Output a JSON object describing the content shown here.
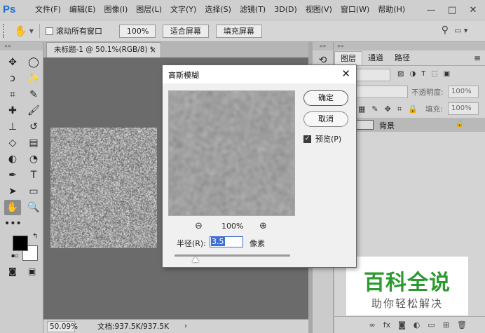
{
  "app": {
    "logo": "Ps",
    "menu": [
      "文件(F)",
      "编辑(E)",
      "图像(I)",
      "图层(L)",
      "文字(Y)",
      "选择(S)",
      "滤镜(T)",
      "3D(D)",
      "视图(V)",
      "窗口(W)",
      "帮助(H)"
    ],
    "window_controls": {
      "minimize": "—",
      "maximize": "□",
      "close": "✕"
    }
  },
  "options_bar": {
    "scroll_all_label": "滚动所有窗口",
    "zoom_value": "100%",
    "fit_screen_label": "适合屏幕",
    "fill_screen_label": "填充屏幕"
  },
  "toolbar": {
    "header": "««",
    "tools": [
      {
        "name": "move-tool",
        "glyph": "✥"
      },
      {
        "name": "ellipse-marquee-tool",
        "glyph": "◯"
      },
      {
        "name": "lasso-tool",
        "glyph": "ↄ"
      },
      {
        "name": "magic-wand-tool",
        "glyph": "✨"
      },
      {
        "name": "crop-tool",
        "glyph": "⌗"
      },
      {
        "name": "eyedropper-tool",
        "glyph": "✎"
      },
      {
        "name": "healing-brush-tool",
        "glyph": "✚"
      },
      {
        "name": "brush-tool",
        "glyph": "🖌"
      },
      {
        "name": "clone-stamp-tool",
        "glyph": "⊥"
      },
      {
        "name": "history-brush-tool",
        "glyph": "↺"
      },
      {
        "name": "eraser-tool",
        "glyph": "◇"
      },
      {
        "name": "gradient-tool",
        "glyph": "▤"
      },
      {
        "name": "blur-tool",
        "glyph": "◐"
      },
      {
        "name": "dodge-tool",
        "glyph": "◔"
      },
      {
        "name": "pen-tool",
        "glyph": "✒"
      },
      {
        "name": "type-tool",
        "glyph": "T"
      },
      {
        "name": "path-selection-tool",
        "glyph": "➤"
      },
      {
        "name": "rectangle-tool",
        "glyph": "▭"
      },
      {
        "name": "hand-tool",
        "glyph": "✋"
      },
      {
        "name": "zoom-tool",
        "glyph": "🔍"
      },
      {
        "name": "more-tools",
        "glyph": "•••"
      }
    ],
    "active_tool": "hand-tool",
    "foreground_color": "#000000",
    "background_color": "#ffffff"
  },
  "document": {
    "tab_title": "未标题-1 @ 50.1%(RGB/8) *",
    "tab_close": "×",
    "zoom": "50.09%",
    "info": "文档:937.5K/937.5K",
    "status_arrow": "›"
  },
  "layers_panel": {
    "header": "»»",
    "tabs": [
      "图层",
      "通道",
      "路径"
    ],
    "active_tab": "图层",
    "kind_filter": "类型",
    "opacity_label": "不透明度:",
    "opacity_value": "100%",
    "fill_label": "填充:",
    "fill_value": "100%",
    "layers": [
      {
        "name": "背景",
        "locked": true
      }
    ]
  },
  "watermark": {
    "title": "百科全说",
    "subtitle": "助你轻松解决",
    "color": "#2c9a2f"
  },
  "dialog": {
    "title": "高斯模糊",
    "ok_label": "确定",
    "cancel_label": "取消",
    "preview_label": "预览(P)",
    "preview_checked": true,
    "zoom_percent": "100%",
    "radius_label": "半径(R):",
    "radius_value": "3.5",
    "radius_unit": "像素",
    "slider_position": 0.18
  }
}
